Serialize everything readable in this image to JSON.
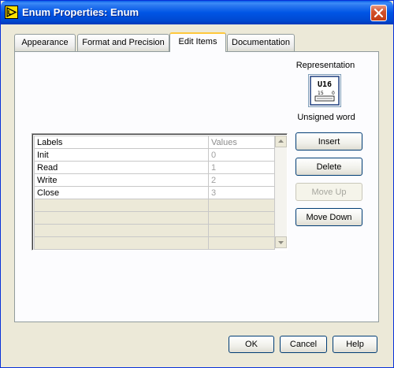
{
  "window": {
    "title": "Enum Properties: Enum"
  },
  "tabs": [
    {
      "label": "Appearance"
    },
    {
      "label": "Format and Precision"
    },
    {
      "label": "Edit Items"
    },
    {
      "label": "Documentation"
    }
  ],
  "representation": {
    "label": "Representation",
    "type_text": "U16",
    "type_name": "Unsigned word",
    "icon_small_digits": "15",
    "icon_small_zero": "0"
  },
  "table": {
    "headers": {
      "labels": "Labels",
      "values": "Values"
    },
    "rows": [
      {
        "label": "Init",
        "value": "0"
      },
      {
        "label": "Read",
        "value": "1"
      },
      {
        "label": "Write",
        "value": "2"
      },
      {
        "label": "Close",
        "value": "3"
      }
    ]
  },
  "buttons": {
    "insert": "Insert",
    "delete": "Delete",
    "move_up": "Move Up",
    "move_down": "Move Down"
  },
  "footer": {
    "ok": "OK",
    "cancel": "Cancel",
    "help": "Help"
  },
  "colors": {
    "titlebar": "#0055e5",
    "window_bg": "#ece9d8",
    "active_tab_accent": "#ffc83c"
  }
}
